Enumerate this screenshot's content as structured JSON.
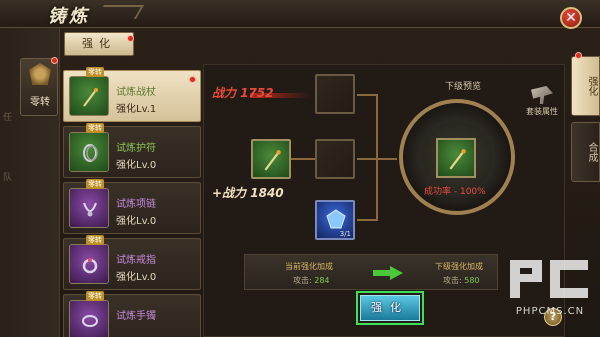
{
  "window": {
    "title": "铸炼"
  },
  "left_nav": {
    "label": "零转",
    "side_text_1": "任",
    "side_text_2": "队"
  },
  "tabs": {
    "strengthen": "强化"
  },
  "items": [
    {
      "name": "试炼战杖",
      "level": "强化Lv.1",
      "badge": "零转",
      "rarity": "green"
    },
    {
      "name": "试炼护符",
      "level": "强化Lv.0",
      "badge": "零转",
      "rarity": "green"
    },
    {
      "name": "试炼项链",
      "level": "强化Lv.0",
      "badge": "零转",
      "rarity": "purple"
    },
    {
      "name": "试炼戒指",
      "level": "强化Lv.0",
      "badge": "零转",
      "rarity": "purple"
    },
    {
      "name": "试炼手镯",
      "level": "",
      "badge": "零转",
      "rarity": "purple"
    }
  ],
  "power": {
    "current_label": "战力",
    "current_value": "1752",
    "gain_label": "+战力",
    "gain_value": "1840"
  },
  "material": {
    "count": "3/1"
  },
  "preview": {
    "label": "下级预览",
    "success_rate": "成功率 - 100%"
  },
  "set_attr": {
    "label": "套装属性"
  },
  "right_tabs": {
    "active": "强化",
    "inactive": "合成"
  },
  "bonus": {
    "current_label": "当前强化加成",
    "current_stat": "攻击:",
    "current_value": "284",
    "next_label": "下级强化加成",
    "next_stat": "攻击:",
    "next_value": "580"
  },
  "actions": {
    "strengthen_button": "强化",
    "help": "?"
  },
  "watermark": {
    "text": "PHPCMS.CN"
  }
}
